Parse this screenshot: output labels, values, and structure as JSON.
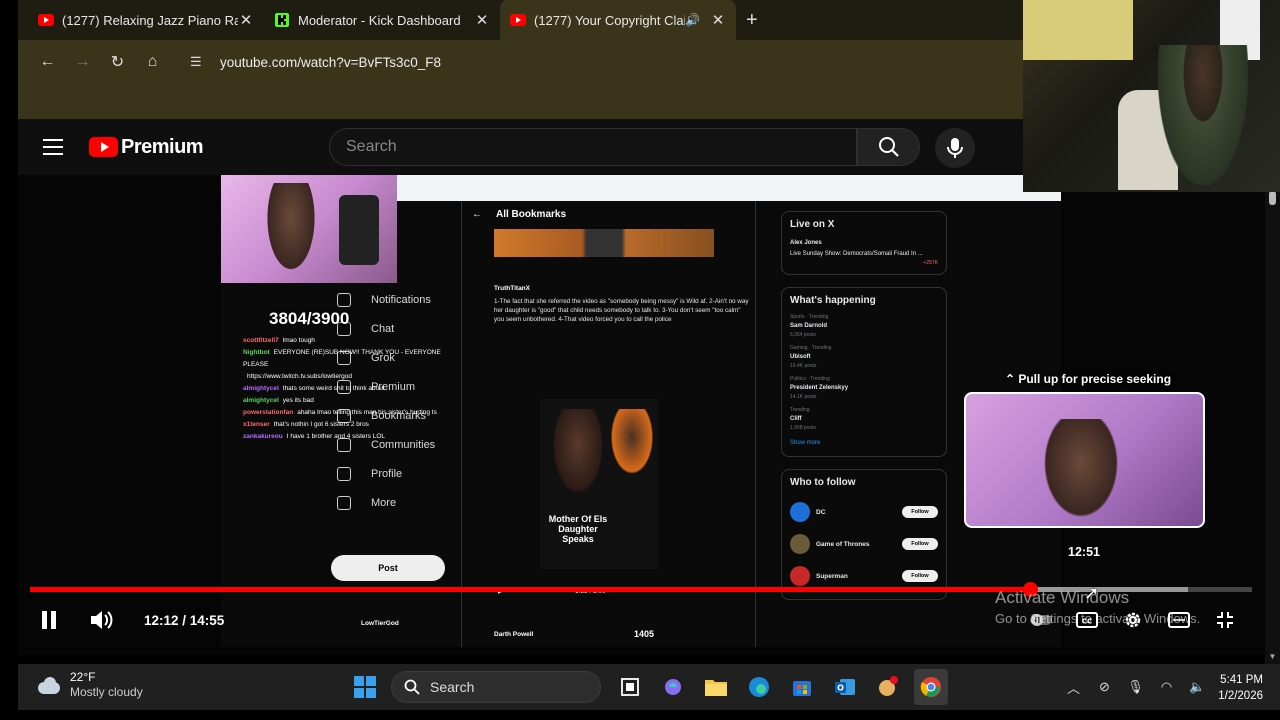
{
  "browser": {
    "tabs": [
      {
        "title": "(1277) Relaxing Jazz Piano Radi",
        "favicon": "youtube-icon",
        "active": false
      },
      {
        "title": "Moderator - Kick Dashboard",
        "favicon": "kick-icon",
        "active": false
      },
      {
        "title": "(1277) Your Copyright Clain",
        "favicon": "youtube-icon",
        "active": true,
        "muted_icon": "speaker-icon"
      }
    ],
    "url": "youtube.com/watch?v=BvFTs3c0_F8"
  },
  "youtube": {
    "logo_text": "Premium",
    "search_placeholder": "Search"
  },
  "video_content": {
    "sub_counter": "3804/3900",
    "x_nav": [
      "Notifications",
      "Chat",
      "Grok",
      "Premium",
      "Bookmarks",
      "Communities",
      "Profile",
      "More"
    ],
    "x_post_button": "Post",
    "x_feed_title": "All Bookmarks",
    "tweet_author": "TruthTitanX",
    "tweet_text": "1-The fact that she referred the video as \"somebody being messy\" is Wild af. 2-Ain't no way her daughter is \"good\" that child needs somebody to talk to. 3-You don't seem \"too calm\" you seem unbothered. 4-That video forced you to call the police",
    "tweet_caption": "Mother Of Els Daughter Speaks",
    "tweet_video_time": "1:55 / 2:00",
    "chat_lines": [
      {
        "user": "scottfitzell7",
        "msg": "lmao tough",
        "color": "red"
      },
      {
        "user": "Nightbot",
        "msg": "EVERYONE (RE)SUB NOW!! THANK YOU - EVERYONE PLEASE",
        "color": "green"
      },
      {
        "user": "",
        "msg": "https://www.twitch.tv.subs/lowtiergod",
        "color": "red"
      },
      {
        "user": "almightycel",
        "msg": "thats some weird shit to think about",
        "color": "purple"
      },
      {
        "user": "almightycel",
        "msg": "yes its bad",
        "color": "green"
      },
      {
        "user": "powerstationfan",
        "msg": "ahaha lmao telling this man his sister's hurting ts",
        "color": "red"
      },
      {
        "user": "x1tenser",
        "msg": "that's nothin I got 6 sisters 2 bros",
        "color": "red"
      },
      {
        "user": "zankakureou",
        "msg": "I have 1 brother and 4 sisters LOL",
        "color": "purple"
      }
    ],
    "live_title": "Live on X",
    "live_line1": "Alex Jones",
    "live_line2": "Live Sunday Show: Democrats/Somali Fraud In ...",
    "live_count": "+257K",
    "happening_title": "What's happening",
    "trends": [
      {
        "cat": "Sports · Trending",
        "name": "Sam Darnold",
        "posts": "5,354 posts"
      },
      {
        "cat": "Gaming · Trending",
        "name": "Ubisoft",
        "posts": "10.4K posts"
      },
      {
        "cat": "Politics · Trending",
        "name": "President Zelenskyy",
        "posts": "14.1K posts"
      },
      {
        "cat": "Trending",
        "name": "Cliff",
        "posts": "1,958 posts"
      }
    ],
    "show_more": "Show more",
    "who_title": "Who to follow",
    "who": [
      {
        "name": "DC",
        "btn": "Follow"
      },
      {
        "name": "Game of Thrones",
        "btn": "Follow"
      },
      {
        "name": "Superman",
        "btn": "Follow"
      }
    ],
    "bottom_author": "LowTierGod",
    "bottom_author2": "Darth Powell",
    "count_badge": "1405"
  },
  "player": {
    "seek_hint": "Pull up for precise seeking",
    "hover_time": "12:51",
    "current_time": "12:12",
    "duration": "14:55",
    "time_display": "12:12 / 14:55",
    "progress_fraction": 0.818,
    "buffer_fraction": 0.948,
    "accent": "#ff0000"
  },
  "watermark": {
    "line1": "Activate Windows",
    "line2": "Go to Settings to activate Windows."
  },
  "taskbar": {
    "weather_temp": "22°F",
    "weather_desc": "Mostly cloudy",
    "search_label": "Search",
    "time": "5:41 PM",
    "date": "1/2/2026"
  }
}
